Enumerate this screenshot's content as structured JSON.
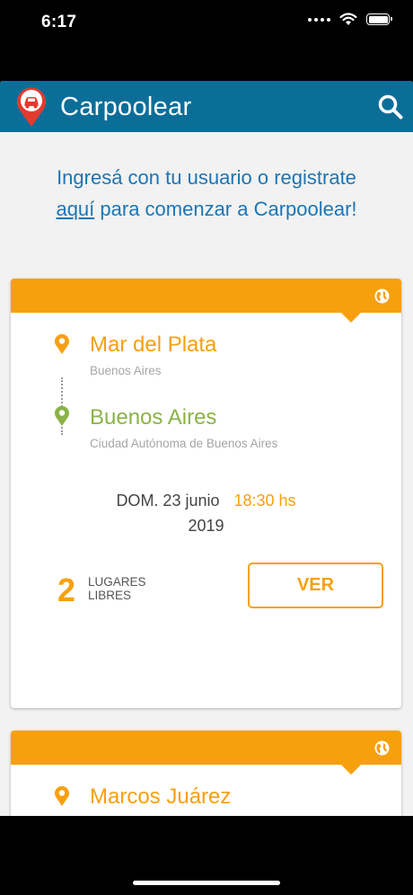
{
  "status": {
    "time": "6:17"
  },
  "header": {
    "title": "Carpoolear"
  },
  "intro": {
    "before": "Ingresá con tu usuario o registrate ",
    "link": "aquí",
    "after": " para comenzar a Carpoolear!"
  },
  "trips": [
    {
      "origin": {
        "city": "Mar del Plata",
        "province": "Buenos Aires"
      },
      "destination": {
        "city": "Buenos Aires",
        "province": "Ciudad Autónoma de Buenos Aires"
      },
      "date": "DOM. 23 junio",
      "time": "18:30 hs",
      "year": "2019",
      "seats": "2",
      "seats_label_1": "LUGARES",
      "seats_label_2": "LIBRES",
      "button": "VER"
    },
    {
      "origin": {
        "city": "Marcos Juárez"
      }
    }
  ],
  "colors": {
    "header": "#0b6e99",
    "accent": "#f7a00e",
    "destination": "#8ab347",
    "intro_text": "#1c75b5"
  },
  "icons": {
    "logo": "car-pin-logo-icon",
    "search": "search-icon",
    "globe": "globe-icon",
    "origin_pin": "map-pin-icon",
    "destination_pin": "map-pin-icon"
  }
}
